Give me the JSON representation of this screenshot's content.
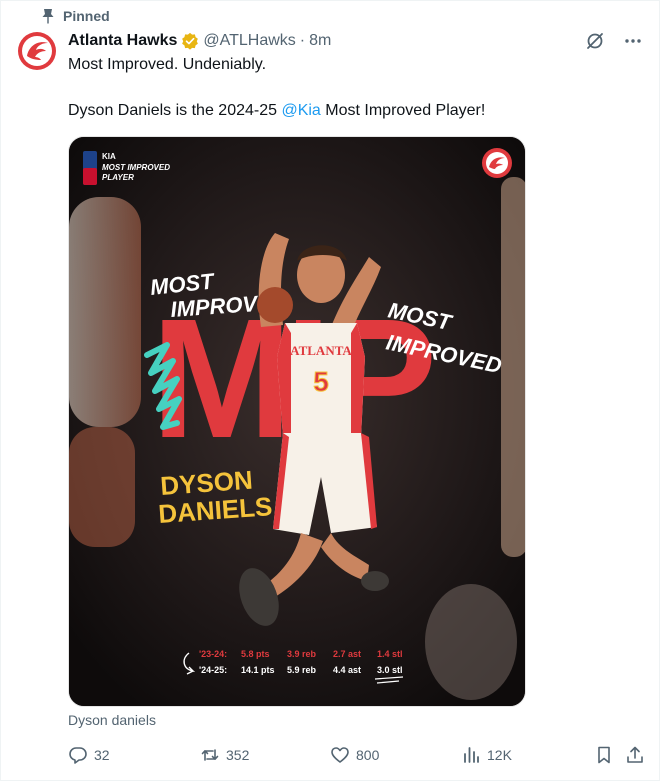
{
  "pinned": {
    "label": "Pinned"
  },
  "author": {
    "name": "Atlanta Hawks",
    "handle": "@ATLHawks",
    "separator": "·",
    "time": "8m"
  },
  "tweet": {
    "line1": "Most Improved. Undeniably.",
    "line2_before": "Dyson Daniels is the 2024-25 ",
    "line2_mention": "@Kia",
    "line2_after": " Most Improved Player!"
  },
  "media": {
    "badge_line1": "MOST IMPROVED",
    "badge_line2": "PLAYER",
    "headline_left_1": "MOST",
    "headline_left_2": "IMPROVED",
    "headline_right_1": "MOST",
    "headline_right_2": "IMPROVED",
    "big_text": "MIP",
    "player_first": "DYSON",
    "player_last": "DANIELS",
    "jersey_text": "ATLANTA",
    "jersey_number": "5",
    "stats": [
      {
        "season": "'23-24:",
        "pts": "5.8 pts",
        "reb": "3.9 reb",
        "ast": "2.7 ast",
        "stl": "1.4 stl"
      },
      {
        "season": "'24-25:",
        "pts": "14.1 pts",
        "reb": "5.9 reb",
        "ast": "4.4 ast",
        "stl": "3.0 stl"
      }
    ]
  },
  "caption": "Dyson daniels",
  "metrics": {
    "replies": "32",
    "reposts": "352",
    "likes": "800",
    "views": "12K"
  },
  "colors": {
    "hawks_red": "#e03a3e",
    "link_blue": "#1d9bf0",
    "muted": "#536471",
    "gold": "#f5c33b"
  }
}
